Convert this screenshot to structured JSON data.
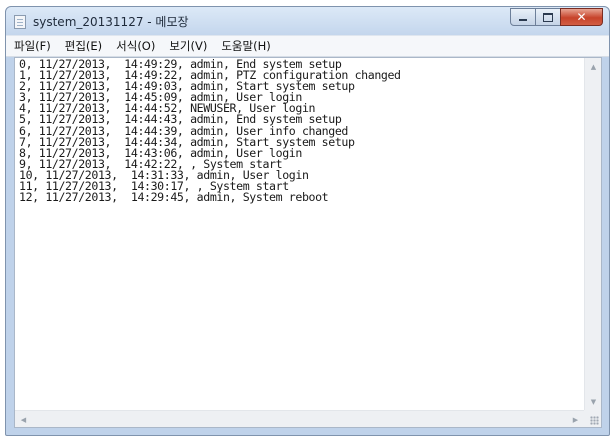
{
  "window": {
    "title": "system_20131127 - 메모장",
    "controls": {
      "close_label": "✕"
    }
  },
  "menu": [
    "파일(F)",
    "편집(E)",
    "서식(O)",
    "보기(V)",
    "도움말(H)"
  ],
  "content": {
    "lines": [
      "0, 11/27/2013,  14:49:29, admin, End system setup",
      "1, 11/27/2013,  14:49:22, admin, PTZ configuration changed",
      "2, 11/27/2013,  14:49:03, admin, Start system setup",
      "3, 11/27/2013,  14:45:09, admin, User login",
      "4, 11/27/2013,  14:44:52, NEWUSER, User login",
      "5, 11/27/2013,  14:44:43, admin, End system setup",
      "6, 11/27/2013,  14:44:39, admin, User info changed",
      "7, 11/27/2013,  14:44:34, admin, Start system setup",
      "8, 11/27/2013,  14:43:06, admin, User login",
      "9, 11/27/2013,  14:42:22, , System start",
      "10, 11/27/2013,  14:31:33, admin, User login",
      "11, 11/27/2013,  14:30:17, , System start",
      "12, 11/27/2013,  14:29:45, admin, System reboot"
    ]
  },
  "scrollbars": {
    "up": "▲",
    "down": "▼",
    "left": "◀",
    "right": "▶"
  }
}
